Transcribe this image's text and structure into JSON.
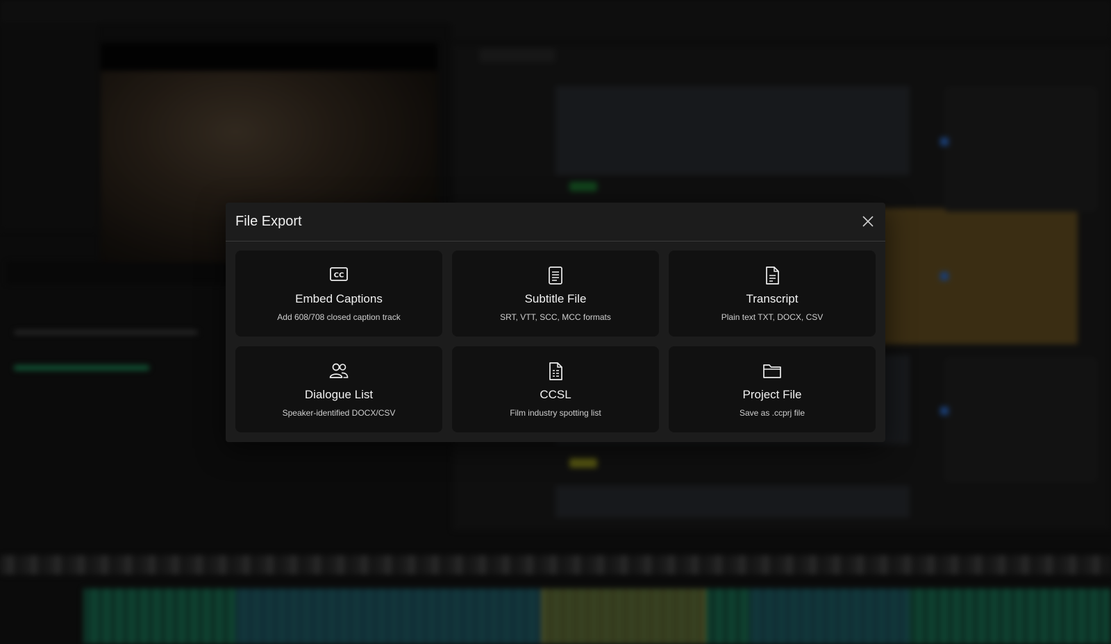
{
  "modal": {
    "title": "File Export",
    "options": [
      {
        "label": "Embed Captions",
        "description": "Add 608/708 closed caption track",
        "icon": "closed-caption-icon"
      },
      {
        "label": "Subtitle File",
        "description": "SRT, VTT, SCC, MCC formats",
        "icon": "document-lines-icon"
      },
      {
        "label": "Transcript",
        "description": "Plain text TXT, DOCX, CSV",
        "icon": "document-icon"
      },
      {
        "label": "Dialogue List",
        "description": "Speaker-identified DOCX/CSV",
        "icon": "people-icon"
      },
      {
        "label": "CCSL",
        "description": "Film industry spotting list",
        "icon": "document-list-icon"
      },
      {
        "label": "Project File",
        "description": "Save as .ccprj file",
        "icon": "folder-icon"
      }
    ]
  },
  "colors": {
    "modal_bg": "#1c1c1c",
    "card_bg": "#111111",
    "text": "#f2f2f2",
    "timeline_green": "#1d7a5a",
    "highlight_gold": "#c9a13a"
  }
}
